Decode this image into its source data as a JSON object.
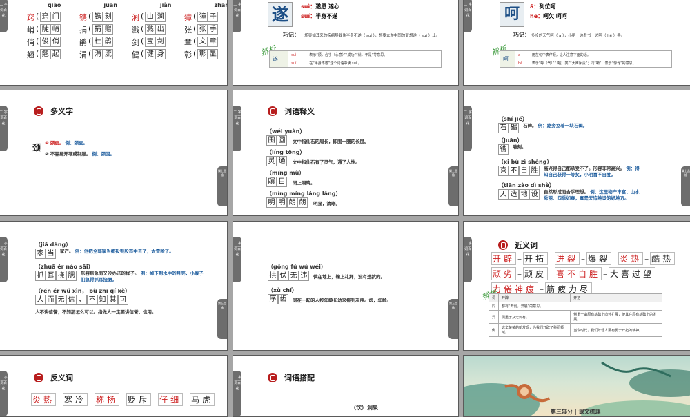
{
  "side_tab": "二 字词百花",
  "corner_badge": "樂上品檢",
  "bianxi": "辨析",
  "s1": {
    "pinyin": [
      "qiào",
      "juān",
      "jiàn",
      "zhāng"
    ],
    "rows": [
      [
        {
          "c": "窍",
          "r": true
        },
        {
          "w": "窍门"
        },
        {
          "c": "镌",
          "r": true
        },
        {
          "w": "镌刻"
        },
        {
          "c": "涧",
          "r": true
        },
        {
          "w": "山涧"
        },
        {
          "c": "獐",
          "r": true
        },
        {
          "w": "獐子"
        }
      ],
      [
        {
          "c": "峭"
        },
        {
          "w": "陡峭"
        },
        {
          "c": "捐"
        },
        {
          "w": "捐赠"
        },
        {
          "c": "溅"
        },
        {
          "w": "溅出"
        },
        {
          "c": "张"
        },
        {
          "w": "张手"
        }
      ],
      [
        {
          "c": "俏"
        },
        {
          "w": "俊俏"
        },
        {
          "c": "鹃"
        },
        {
          "w": "杜鹃"
        },
        {
          "c": "剑"
        },
        {
          "w": "宝剑"
        },
        {
          "c": "章"
        },
        {
          "w": "文章"
        }
      ],
      [
        {
          "c": "翘"
        },
        {
          "w": "翘起"
        },
        {
          "c": "涓"
        },
        {
          "w": "涓流"
        },
        {
          "c": "健"
        },
        {
          "w": "健身"
        },
        {
          "c": "彰"
        },
        {
          "w": "彰显"
        }
      ]
    ]
  },
  "s2": {
    "char": "遂",
    "p1": "suì：",
    "d1": "遂愿 遂心",
    "p2": "suí：",
    "d2": "半身不遂",
    "tip_label": "巧记：",
    "tip": "一场突如其来的疾病导致伟半身不遂（ suí ），想要去游中国的梦想遂（ suì ）止。",
    "table": [
      [
        "suì",
        "表示“顺，合乎（心意）”“成功”“就，于是”等意思。"
      ],
      [
        "suí",
        "在“半身不遂”这个词语中读 suí 。"
      ]
    ],
    "table_head": "遂"
  },
  "s3": {
    "char": "呵",
    "p1": "ā：",
    "d1": "列位呵",
    "p2": "hē：",
    "d2": "呵欠 呵呵",
    "tip_label": "巧记：",
    "tip": "多冷的天气呵（ a ），小明一边看书一边呵（ hē ）手。",
    "table": [
      [
        "a",
        "用在句中表停顿，让人注意下面的话。"
      ],
      [
        "hē",
        "表示“呼（气）”“（嘘）笑”“大声斥责”；同“嗬”，表示“惊讶”的意思。"
      ]
    ],
    "table_head": "呵"
  },
  "s4": {
    "title": "多义字",
    "char": "颈",
    "i1_num": "①",
    "i1": "颈皮。",
    "i1_ex": "例：颈皮。",
    "i2_num": "②",
    "i2": "不容易开导或制服。",
    "i2_ex": "例：颈固。"
  },
  "s5": {
    "title": "词语释义",
    "items": [
      {
        "py": "（wéi yuàn）",
        "word": "围圆",
        "def": "文中指仙石的周长，即围一圈的长度。"
      },
      {
        "py": "（líng tōng）",
        "word": "灵通",
        "def": "文中指仙石有了灵气，通了人性。"
      },
      {
        "py": "（míng mù）",
        "word": "瞑目",
        "def": "闭上眼睛。"
      },
      {
        "py": "（míng míng lǎng lǎng）",
        "word": "明明朗朗",
        "def": "明显，清晰。"
      }
    ]
  },
  "s6": {
    "items": [
      {
        "py": "（shí jié）",
        "word": "石碣",
        "def": "石碑。",
        "ex": "例：路旁立着一块石碣。"
      },
      {
        "py": "（juān）",
        "word": "镌",
        "def": "雕刻。",
        "ex": ""
      },
      {
        "py": "（xǐ bù zì shèng）",
        "word": "喜不自胜",
        "def": "高兴得自己都承受不了。形容非常高兴。",
        "ex": "例：得知自己获得一等奖，小明喜不自胜。"
      },
      {
        "py": "（tiān zào dì shè）",
        "word": "天造地设",
        "def": "自然形成而合乎理想。",
        "ex": "例：这里物产丰富、山水秀丽、四季如春，真是天造地设的好地方。"
      }
    ]
  },
  "s7": {
    "items": [
      {
        "py": "（jiā dàng）",
        "word": "家当",
        "def": "家产。",
        "ex": "例：他把全部家当都投到股市中去了，太冒险了。"
      },
      {
        "py": "（zhuā ěr náo sāi）",
        "word": "抓耳挠腮",
        "def": "形容焦急而又没办法的样子。",
        "ex": "例：掉下到水中的月亮，小猴子们急得抓耳挠腮。"
      },
      {
        "py": "（rén ér wú xìn，  bù zhī qí kě）",
        "word": "人而无信，不知其可",
        "def": "人不讲信誉，不知那怎么可以。指做人一定要讲信誉、信用。",
        "ex": ""
      }
    ]
  },
  "s8": {
    "items": [
      {
        "py": "（gǒng fú wú wéi）",
        "word": "拱伏无违",
        "def": "伏在地上，鞠上礼拜，没有违抗的。"
      },
      {
        "py": "（xù chǐ）",
        "word": "序齿",
        "def": "同在一起的人按年龄长幼来排列次序。齿，年龄。"
      }
    ]
  },
  "s9": {
    "title": "近义词",
    "pairs": [
      {
        "a": "开辟",
        "b": "开拓"
      },
      {
        "a": "迸裂",
        "b": "爆裂"
      },
      {
        "a": "炎热",
        "b": "酷热"
      },
      {
        "a": "顽劣",
        "b": "顽皮"
      },
      {
        "a": "喜不自胜",
        "b": "大喜过望"
      },
      {
        "a": "力倦神疲",
        "b": "筋疲力尽"
      }
    ],
    "table_head": [
      "词",
      "开辟",
      "开拓"
    ],
    "table": [
      [
        "同",
        "都有“开创，开展”的意思。",
        ""
      ],
      [
        "异",
        "侧重于从无到有。",
        "侧重于由原有基础上向外扩展，使其在原有基础上的发展。"
      ],
      [
        "例",
        "这辛某某的新发现，为我们开辟了科研领域。",
        "当今时代，我们年轻人要有勇于开拓的精神。"
      ]
    ]
  },
  "s10": {
    "title": "反义词",
    "pairs": [
      {
        "a": "炎热",
        "b": "寒冷"
      },
      {
        "a": "称扬",
        "b": "贬斥"
      },
      {
        "a": "仔细",
        "b": "马虎"
      }
    ]
  },
  "s11": {
    "title": "词语搭配",
    "item": "（饮）洞泉"
  },
  "s12": {
    "caption": "第三部分 | 课文梳理"
  }
}
